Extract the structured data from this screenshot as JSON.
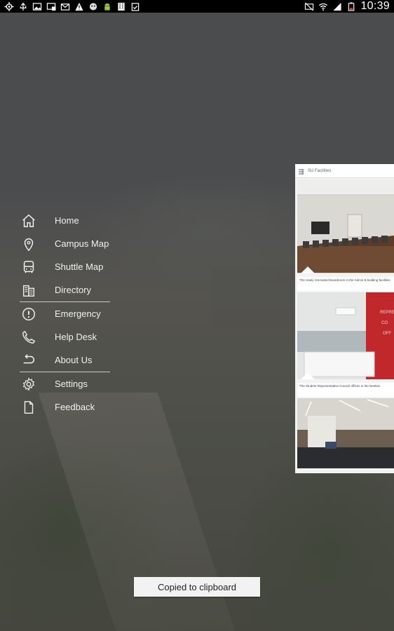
{
  "status_bar": {
    "time": "10:39",
    "left_icons": [
      "gps-icon",
      "usb-icon",
      "image-icon",
      "screen-cast-icon",
      "mail-icon",
      "warning-icon",
      "baby-icon",
      "android-icon",
      "building-icon",
      "clipboard-check-icon"
    ],
    "right_icons": [
      "nfc-muted-icon",
      "wifi-icon",
      "signal-icon",
      "battery-icon"
    ]
  },
  "menu": {
    "items": [
      {
        "label": "Home",
        "icon": "home-icon"
      },
      {
        "label": "Campus Map",
        "icon": "map-pin-icon"
      },
      {
        "label": "Shuttle Map",
        "icon": "bus-icon"
      },
      {
        "label": "Directory",
        "icon": "building-icon"
      },
      {
        "label": "Emergency",
        "icon": "alert-icon"
      },
      {
        "label": "Help Desk",
        "icon": "phone-icon"
      },
      {
        "label": "About Us",
        "icon": "undo-icon"
      },
      {
        "label": "Settings",
        "icon": "gear-icon"
      },
      {
        "label": "Feedback",
        "icon": "document-icon"
      }
    ]
  },
  "preview": {
    "title": "SU Facilities",
    "cards": [
      {
        "caption": "The newly renovated Boardroom in the Admin B building facilities"
      },
      {
        "caption": "The Student Representative Council offices in the Neelsie"
      },
      {
        "caption": ""
      }
    ]
  },
  "toast": {
    "text": "Copied to clipboard"
  },
  "colors": {
    "status_bar": "#000000",
    "toast_bg": "#f2f2f2",
    "menu_text": "#f0f0f0",
    "overlay": "#4a4b4d"
  }
}
